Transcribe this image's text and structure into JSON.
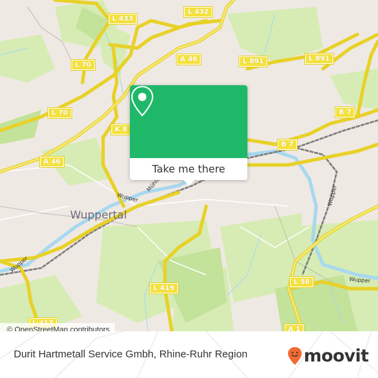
{
  "map": {
    "city_label": "Wuppertal",
    "river_labels": [
      "Wupper",
      "Wupper",
      "Wupper",
      "Wupper",
      "Mühlen"
    ],
    "road_labels": [
      "L 433",
      "L 432",
      "L 70",
      "L 70",
      "A 46",
      "A 46",
      "L 891",
      "L 891",
      "K 8",
      "B 7",
      "B 7",
      "L 58",
      "A 1",
      "L 419",
      "L 417"
    ],
    "colors": {
      "land": "#efe9e4",
      "forest": "#cce8a6",
      "park": "#dff0c8",
      "road_major": "#f5e23c",
      "water": "#a7d8f0",
      "rail": "#7a7a7a"
    }
  },
  "popup": {
    "icon": "location-pin-icon",
    "button_label": "Take me there",
    "color": "#1fb869"
  },
  "attribution": "© OpenStreetMap contributors",
  "footer": {
    "title": "Durit Hartmetall Service Gmbh, Rhine-Ruhr Region",
    "logo_text": "moovit",
    "logo_icon": "moovit-face-pin-icon",
    "logo_color": "#f26b33"
  }
}
